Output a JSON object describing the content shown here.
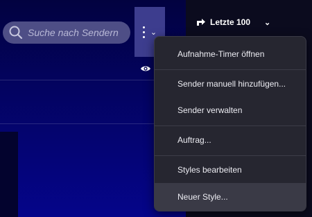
{
  "search": {
    "placeholder": "Suche nach Sendern"
  },
  "toolbar": {
    "more_icon": "more-vertical-icon",
    "visibility_icon": "eye-icon",
    "recent": {
      "label": "Letzte 100",
      "icon": "recent-arrow-icon"
    }
  },
  "menu": {
    "items": [
      {
        "label": "Aufnahme-Timer öffnen"
      },
      {
        "label": "Sender manuell hinzufügen..."
      },
      {
        "label": "Sender verwalten"
      },
      {
        "label": "Auftrag..."
      },
      {
        "label": "Styles bearbeiten"
      },
      {
        "label": "Neuer Style...",
        "highlighted": true
      }
    ]
  },
  "colors": {
    "menu_background": "#262630",
    "menu_hover": "#3a3a46",
    "search_background": "#4e4e86",
    "more_button_background": "#3d3d8e"
  }
}
